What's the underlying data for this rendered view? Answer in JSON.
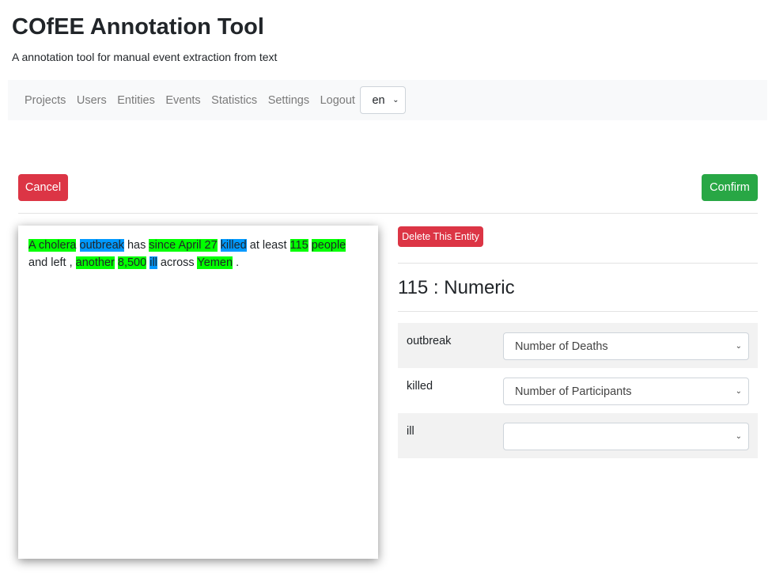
{
  "header": {
    "title": "COfEE Annotation Tool",
    "subtitle": "A annotation tool for manual event extraction from text"
  },
  "nav": {
    "items": [
      "Projects",
      "Users",
      "Entities",
      "Events",
      "Statistics",
      "Settings",
      "Logout"
    ],
    "language": "en"
  },
  "actions": {
    "cancel": "Cancel",
    "confirm": "Confirm"
  },
  "text": {
    "tokens": [
      {
        "t": "A cholera",
        "h": "green"
      },
      {
        "t": "outbreak",
        "h": "blue"
      },
      {
        "t": "has"
      },
      {
        "t": "since April 27",
        "h": "green"
      },
      {
        "t": "killed",
        "h": "blue"
      },
      {
        "t": "at least"
      },
      {
        "t": "115",
        "h": "green"
      },
      {
        "t": "people",
        "h": "green"
      },
      {
        "t": "and"
      },
      {
        "t": "left ,"
      },
      {
        "t": "another",
        "h": "green"
      },
      {
        "t": "8,500",
        "h": "green"
      },
      {
        "t": "ill",
        "h": "blue"
      },
      {
        "t": "across"
      },
      {
        "t": "Yemen",
        "h": "green"
      },
      {
        "t": "."
      }
    ]
  },
  "colors": {
    "green": "#00ff00",
    "blue": "#0099ff",
    "danger": "#dc3545",
    "success": "#28a745"
  },
  "entity": {
    "delete_label": "Delete This Entity",
    "heading": "115 : Numeric",
    "roles": [
      {
        "label": "outbreak",
        "value": "Number of Deaths"
      },
      {
        "label": "killed",
        "value": "Number of Participants"
      },
      {
        "label": "ill",
        "value": ""
      }
    ]
  }
}
